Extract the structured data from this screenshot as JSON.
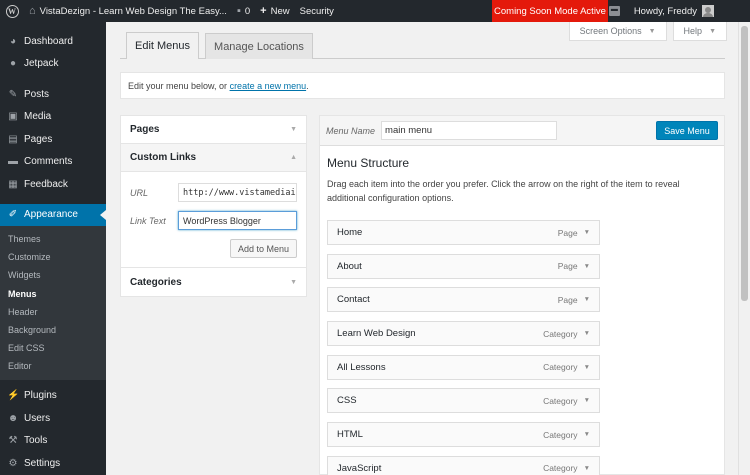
{
  "admin_bar": {
    "site_title": "VistaDezign - Learn Web Design The Easy...",
    "comments_count": "0",
    "new_label": "New",
    "security_label": "Security",
    "coming_soon_label": "Coming Soon Mode Active",
    "howdy_label": "Howdy, Freddy",
    "coming_soon_color": "#e4190b"
  },
  "sidebar": {
    "items_top": [
      {
        "label": "Dashboard",
        "icon": "dashboard-icon"
      },
      {
        "label": "Jetpack",
        "icon": "jetpack-icon"
      },
      {
        "label": "Posts",
        "icon": "pin-icon"
      },
      {
        "label": "Media",
        "icon": "media-icon"
      },
      {
        "label": "Pages",
        "icon": "pages-icon"
      },
      {
        "label": "Comments",
        "icon": "comment-icon"
      },
      {
        "label": "Feedback",
        "icon": "feedback-icon"
      }
    ],
    "active": {
      "label": "Appearance",
      "icon": "paintbrush-icon"
    },
    "submenu": [
      "Themes",
      "Customize",
      "Widgets",
      "Menus",
      "Header",
      "Background",
      "Edit CSS",
      "Editor"
    ],
    "submenu_current": "Menus",
    "items_bottom": [
      {
        "label": "Plugins",
        "icon": "plugin-icon"
      },
      {
        "label": "Users",
        "icon": "users-icon"
      },
      {
        "label": "Tools",
        "icon": "wrench-icon"
      },
      {
        "label": "Settings",
        "icon": "settings-icon"
      }
    ],
    "accent_color": "#0073aa"
  },
  "screen_options": {
    "label": "Screen Options"
  },
  "help": {
    "label": "Help"
  },
  "tabs": {
    "edit_menus": "Edit Menus",
    "manage_locations": "Manage Locations"
  },
  "notice": {
    "text_before": "Edit your menu below, or ",
    "link": "create a new menu",
    "text_after": "."
  },
  "accordion": {
    "pages": "Pages",
    "custom_links": "Custom Links",
    "url_label": "URL",
    "url_value": "http://www.vistamediai",
    "link_text_label": "Link Text",
    "link_text_value": "WordPress Blogger",
    "add_button": "Add to Menu",
    "categories": "Categories"
  },
  "menu": {
    "name_label": "Menu Name",
    "name_value": "main menu",
    "save_button": "Save Menu",
    "structure_title": "Menu Structure",
    "instructions": "Drag each item into the order you prefer. Click the arrow on the right of the item to reveal additional configuration options.",
    "items": [
      {
        "title": "Home",
        "type": "Page"
      },
      {
        "title": "About",
        "type": "Page"
      },
      {
        "title": "Contact",
        "type": "Page"
      },
      {
        "title": "Learn Web Design",
        "type": "Category"
      },
      {
        "title": "All Lessons",
        "type": "Category"
      },
      {
        "title": "CSS",
        "type": "Category"
      },
      {
        "title": "HTML",
        "type": "Category"
      },
      {
        "title": "JavaScript",
        "type": "Category"
      }
    ]
  }
}
